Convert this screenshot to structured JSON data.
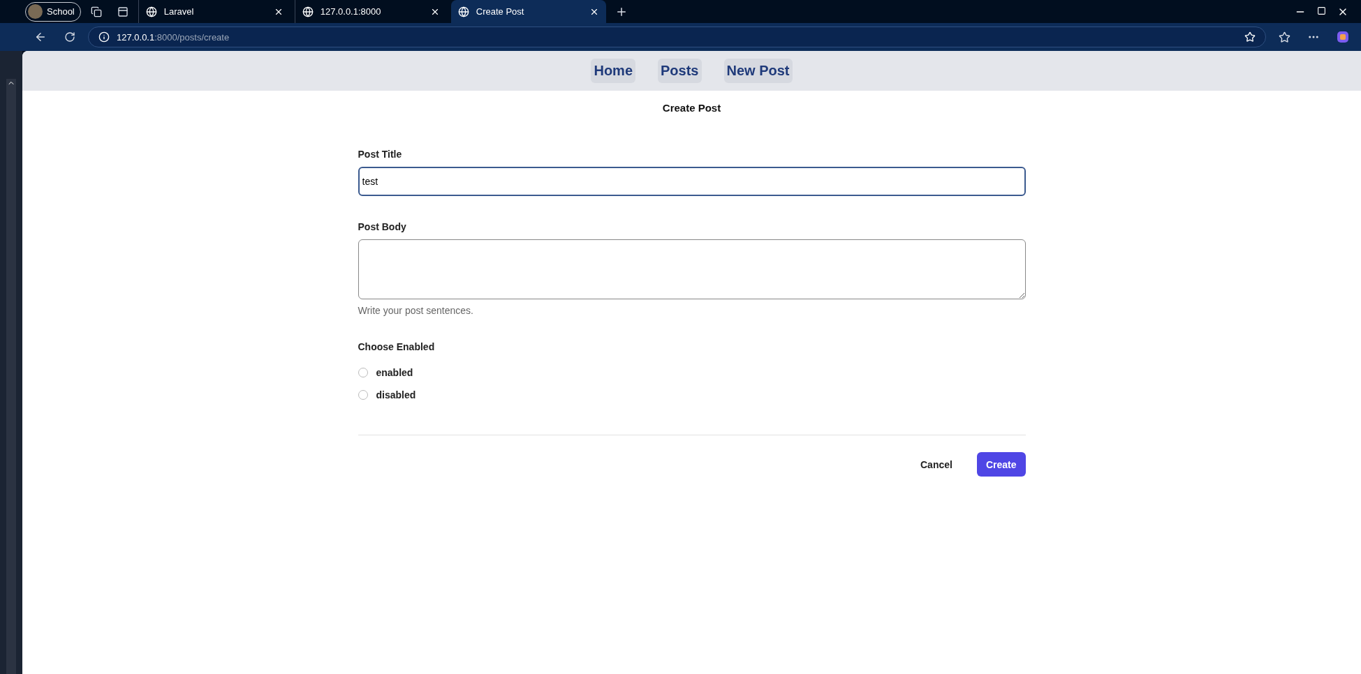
{
  "browser": {
    "profile": "School",
    "tabs": [
      {
        "title": "Laravel",
        "selected": false
      },
      {
        "title": "127.0.0.1:8000",
        "selected": false
      },
      {
        "title": "Create Post",
        "selected": true
      }
    ],
    "url_host": "127.0.0.1",
    "url_path": ":8000/posts/create"
  },
  "nav": {
    "links": [
      {
        "label": "Home"
      },
      {
        "label": "Posts"
      },
      {
        "label": "New Post"
      }
    ]
  },
  "heading": "Create Post",
  "form": {
    "title_label": "Post Title",
    "title_value": "test",
    "body_label": "Post Body",
    "body_hint": "Write your post sentences.",
    "choice_label": "Choose Enabled",
    "options": [
      {
        "label": "enabled",
        "selected": false
      },
      {
        "label": "disabled",
        "selected": false
      }
    ]
  },
  "buttons": [
    {
      "label": "Cancel",
      "kind": "plain"
    },
    {
      "label": "Create",
      "kind": "primary"
    }
  ]
}
